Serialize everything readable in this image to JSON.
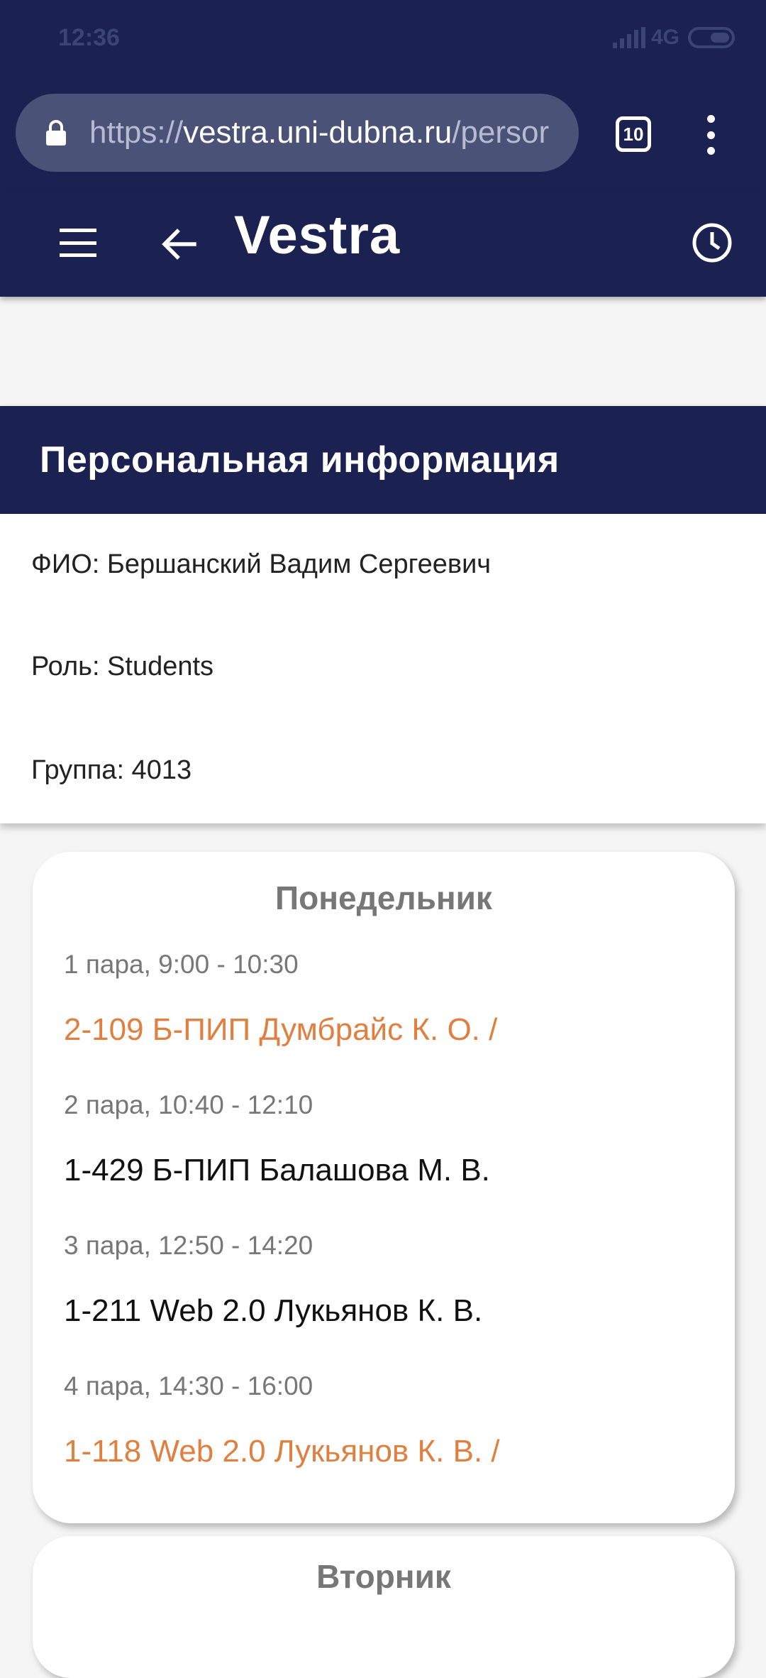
{
  "status_bar": {
    "time": "12:36",
    "network": "4G"
  },
  "browser": {
    "url_scheme": "https://",
    "url_host": "vestra.uni-dubna.ru",
    "url_path": "/persor",
    "tab_count": "10"
  },
  "app_bar": {
    "title": "Vestra"
  },
  "personal_info": {
    "header": "Персональная информация",
    "fio": "ФИО: Бершанский Вадим Сергеевич",
    "role": "Роль: Students",
    "group": "Группа: 4013"
  },
  "schedule": [
    {
      "day": "Понедельник",
      "lessons": [
        {
          "time": "1 пара, 9:00 - 10:30",
          "subject": "2-109 Б-ПИП Думбрайс К. О. /",
          "highlight": true
        },
        {
          "time": "2 пара, 10:40 - 12:10",
          "subject": "1-429 Б-ПИП Балашова М. В.",
          "highlight": false
        },
        {
          "time": "3 пара, 12:50 - 14:20",
          "subject": "1-211 Web 2.0 Лукьянов К. В.",
          "highlight": false
        },
        {
          "time": "4 пара, 14:30 - 16:00",
          "subject": "1-118 Web 2.0 Лукьянов К. В. /",
          "highlight": true
        }
      ]
    },
    {
      "day": "Вторник",
      "lessons": []
    }
  ],
  "colors": {
    "primary": "#1b2251",
    "highlight": "#e07f40",
    "muted_text": "#777777"
  },
  "icons": [
    "lock-icon",
    "tabs-icon",
    "more-vert-icon",
    "menu-icon",
    "back-arrow-icon",
    "clock-icon"
  ]
}
